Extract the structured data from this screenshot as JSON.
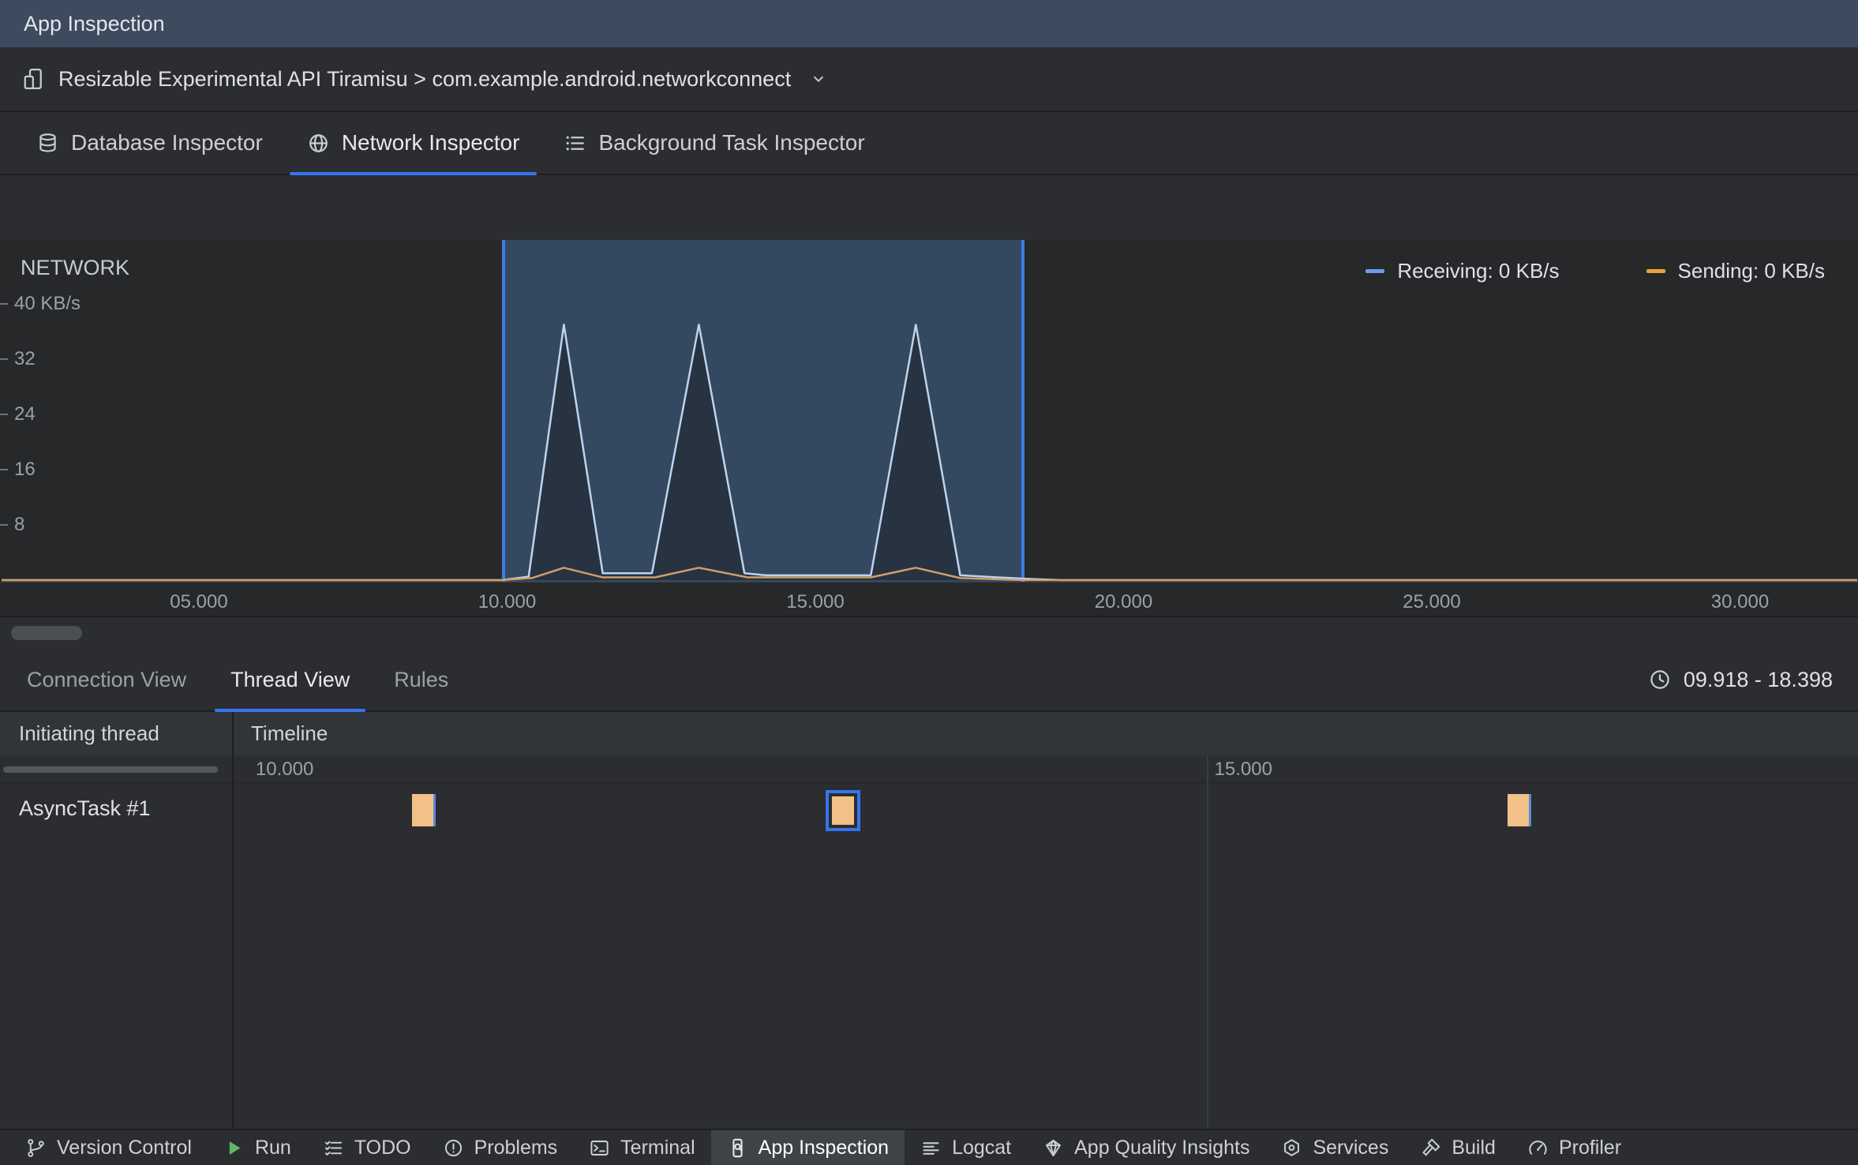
{
  "colors": {
    "accent": "#3574f0",
    "title_bar_bg": "#3d4b5e",
    "panel_bg": "#2b2d30",
    "chart_bg": "#26282a",
    "border": "#1e1f22",
    "text": "#dfe1e5",
    "text_dim": "#9da0a8",
    "selection_border": "#3e7de0",
    "event_block": "#f2c188",
    "run_green": "#5fb865"
  },
  "header": {
    "title": "App Inspection"
  },
  "device_bar": {
    "label": "Resizable Experimental API Tiramisu > com.example.android.networkconnect"
  },
  "inspector_tabs": [
    {
      "label": "Database Inspector",
      "icon": "database-icon",
      "active": false
    },
    {
      "label": "Network Inspector",
      "icon": "globe-icon",
      "active": true
    },
    {
      "label": "Background Task Inspector",
      "icon": "task-list-icon",
      "active": false
    }
  ],
  "network_chart": {
    "title": "NETWORK",
    "legend": [
      {
        "label": "Receiving: 0 KB/s",
        "color": "#6a9ce8"
      },
      {
        "label": "Sending: 0 KB/s",
        "color": "#e8a33d"
      }
    ],
    "chart_data": {
      "type": "area",
      "title": "NETWORK",
      "ylabel": "KB/s",
      "x_unit": "seconds",
      "xlim": [
        1.8,
        31.9
      ],
      "ylim": [
        0,
        44
      ],
      "y_ticks": [
        {
          "label": "40 KB/s",
          "value": 40
        },
        {
          "label": "32",
          "value": 32
        },
        {
          "label": "24",
          "value": 24
        },
        {
          "label": "16",
          "value": 16
        },
        {
          "label": "8",
          "value": 8
        }
      ],
      "x_ticks": [
        {
          "label": "05.000",
          "t": 5
        },
        {
          "label": "10.000",
          "t": 10
        },
        {
          "label": "15.000",
          "t": 15
        },
        {
          "label": "20.000",
          "t": 20
        },
        {
          "label": "25.000",
          "t": 25
        },
        {
          "label": "30.000",
          "t": 30
        }
      ],
      "selection_s": [
        9.918,
        18.398
      ],
      "series": [
        {
          "name": "Receiving",
          "unit": "KB/s",
          "stroke": "#bdd3ef",
          "fill": "rgba(30,33,38,0.55)",
          "points": [
            [
              1.8,
              0
            ],
            [
              9.9,
              0
            ],
            [
              10.35,
              0.5
            ],
            [
              10.92,
              37
            ],
            [
              11.55,
              1
            ],
            [
              12.35,
              1
            ],
            [
              13.11,
              37
            ],
            [
              13.85,
              1
            ],
            [
              14.2,
              0.7
            ],
            [
              15.9,
              0.7
            ],
            [
              16.63,
              37
            ],
            [
              17.35,
              0.7
            ],
            [
              18.4,
              0.2
            ],
            [
              19,
              0
            ],
            [
              31.9,
              0
            ]
          ]
        },
        {
          "name": "Sending",
          "unit": "KB/s",
          "stroke": "#cf9e68",
          "fill": "none",
          "points": [
            [
              1.8,
              0
            ],
            [
              9.9,
              0
            ],
            [
              10.4,
              0.3
            ],
            [
              10.92,
              1.8
            ],
            [
              11.55,
              0.4
            ],
            [
              12.4,
              0.4
            ],
            [
              13.11,
              1.8
            ],
            [
              13.9,
              0.4
            ],
            [
              15.9,
              0.4
            ],
            [
              16.63,
              1.8
            ],
            [
              17.35,
              0.3
            ],
            [
              18.4,
              0
            ],
            [
              31.9,
              0
            ]
          ]
        }
      ]
    }
  },
  "view_tabs": [
    {
      "label": "Connection View",
      "active": false
    },
    {
      "label": "Thread View",
      "active": true
    },
    {
      "label": "Rules",
      "active": false
    }
  ],
  "time_range": {
    "label": "09.918 - 18.398"
  },
  "thread_table": {
    "columns": {
      "thread": "Initiating thread",
      "timeline": "Timeline"
    },
    "range_s": [
      9.918,
      18.398
    ],
    "marks": [
      {
        "label": "10.000",
        "t": 10.0,
        "gridline": false
      },
      {
        "label": "15.000",
        "t": 15.0,
        "gridline": true
      }
    ],
    "rows": [
      {
        "thread": "AsyncTask #1",
        "events": [
          {
            "t": 10.92,
            "selected": false
          },
          {
            "t": 13.11,
            "selected": true
          },
          {
            "t": 16.63,
            "selected": false
          }
        ]
      }
    ]
  },
  "bottom_bar": {
    "items": [
      {
        "label": "Version Control",
        "icon": "branch-icon",
        "active": false
      },
      {
        "label": "Run",
        "icon": "run-icon",
        "active": false
      },
      {
        "label": "TODO",
        "icon": "todo-icon",
        "active": false
      },
      {
        "label": "Problems",
        "icon": "problems-icon",
        "active": false
      },
      {
        "label": "Terminal",
        "icon": "terminal-icon",
        "active": false
      },
      {
        "label": "App Inspection",
        "icon": "app-inspection-icon",
        "active": true
      },
      {
        "label": "Logcat",
        "icon": "logcat-icon",
        "active": false
      },
      {
        "label": "App Quality Insights",
        "icon": "gem-icon",
        "active": false
      },
      {
        "label": "Services",
        "icon": "services-icon",
        "active": false
      },
      {
        "label": "Build",
        "icon": "build-icon",
        "active": false
      },
      {
        "label": "Profiler",
        "icon": "profiler-icon",
        "active": false
      }
    ]
  }
}
